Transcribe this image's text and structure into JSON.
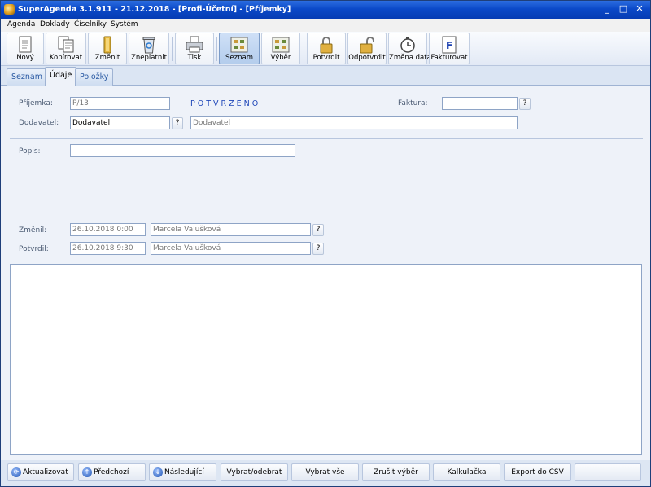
{
  "window": {
    "title": "SuperAgenda 3.1.911 - 21.12.2018 - [Profi-Účetní] - [Příjemky]",
    "minimize": "_",
    "maximize": "□",
    "close": "✕"
  },
  "menu": [
    "Agenda",
    "Doklady",
    "Číselníky",
    "Systém"
  ],
  "toolbar": {
    "novy": "Nový",
    "kopirovat": "Kopírovat",
    "zmenit": "Změnit",
    "zneplatnit": "Zneplatnit",
    "tisk": "Tisk",
    "seznam": "Seznam",
    "vyber": "Výběr",
    "potvrdit": "Potvrdit",
    "odpotvrdit": "Odpotvrdit",
    "zmena_data": "Změna data",
    "fakturovat": "Fakturovat"
  },
  "tabs": [
    "Seznam",
    "Údaje",
    "Položky"
  ],
  "form": {
    "prijemka_label": "Příjemka:",
    "prijemka_value": "P/13",
    "status": "POTVRZENO",
    "faktura_label": "Faktura:",
    "faktura_value": "",
    "dodavatel_label": "Dodavatel:",
    "dodavatel_code": "Dodavatel",
    "dodavatel_name": "Dodavatel",
    "popis_label": "Popis:",
    "popis_value": "",
    "zmenil_label": "Změnil:",
    "zmenil_date": "26.10.2018 0:00",
    "zmenil_user": "Marcela Valušková",
    "potvrdil_label": "Potvrdil:",
    "potvrdil_date": "26.10.2018 9:30",
    "potvrdil_user": "Marcela Valušková",
    "q": "?"
  },
  "bottom": {
    "aktualizovat": "Aktualizovat",
    "predchozi": "Předchozí",
    "nasledujici": "Následující",
    "vybrat_odebrat": "Vybrat/odebrat",
    "vybrat_vse": "Vybrat vše",
    "zrusit_vyber": "Zrušit výběr",
    "kalkulacka": "Kalkulačka",
    "export": "Export do CSV",
    "empty": ""
  },
  "colors": {
    "title_bar": "#0b49c8",
    "status_text": "#1e46b8",
    "accent": "#9fb3d3"
  }
}
